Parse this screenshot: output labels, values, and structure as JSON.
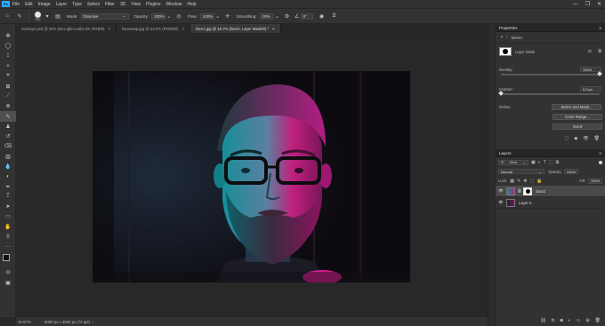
{
  "app": {
    "logo": "Ps"
  },
  "menu": [
    "File",
    "Edit",
    "Image",
    "Layer",
    "Type",
    "Select",
    "Filter",
    "3D",
    "View",
    "Plugins",
    "Window",
    "Help"
  ],
  "window_controls": [
    "—",
    "❐",
    "✕"
  ],
  "options_bar": {
    "brush_size": "312",
    "mode_label": "Mode:",
    "mode_value": "Dissolve",
    "opacity_label": "Opacity:",
    "opacity_value": "100%",
    "flow_label": "Flow:",
    "flow_value": "100%",
    "smoothing_label": "Smoothing:",
    "smoothing_value": "10%",
    "angle_value": "0°"
  },
  "tabs": [
    {
      "label": "overlays.psd @ 25% (50-Light-Leaks-28, RGB/8)",
      "active": false
    },
    {
      "label": "faceswap.jpg @ 33.3% (RGB/8#)",
      "active": false
    },
    {
      "label": "face1.jpg @ 16.7% (face2, Layer Mask/8) *",
      "active": true
    }
  ],
  "status": {
    "zoom": "16.67%",
    "doc_info": "6000 px x 4000 px (72 ppi)"
  },
  "properties": {
    "title": "Properties",
    "section": "Masks",
    "layer_mask_label": "Layer Mask",
    "density_label": "Density:",
    "density_value": "100%",
    "feather_label": "Feather:",
    "feather_value": "0.0 px",
    "refine_label": "Refine:",
    "buttons": [
      "Select and Mask...",
      "Color Range...",
      "Invert"
    ]
  },
  "layers": {
    "title": "Layers",
    "filter_kind": "Kind",
    "blend_mode": "Normal",
    "opacity_label": "Opacity:",
    "opacity_value": "100%",
    "lock_label": "Lock:",
    "fill_label": "Fill:",
    "fill_value": "100%",
    "items": [
      {
        "name": "face2",
        "selected": true
      },
      {
        "name": "Layer 0",
        "selected": false
      }
    ]
  },
  "colors": {
    "accent": "#31a8ff",
    "panel": "#323232",
    "photo_magenta": "#d81c8c",
    "photo_cyan": "#1fa3a8"
  }
}
